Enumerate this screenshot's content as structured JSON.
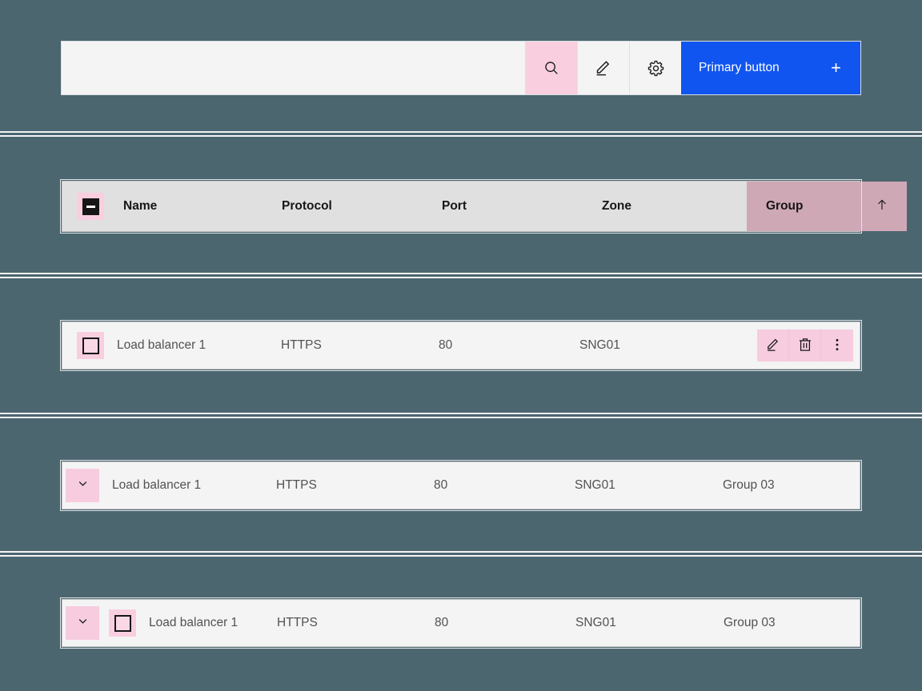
{
  "theme": {
    "background": "#4c6670",
    "surface": "#f4f4f4",
    "header_surface": "#e0e0e0",
    "accent_blue": "#1155f0",
    "highlight_pink": "#f9cfe0",
    "sorted_column": "#cfa8b6",
    "text_primary": "#161616",
    "text_secondary": "#525252",
    "divider": "#f4f4f4"
  },
  "toolbar": {
    "search": {
      "value": "",
      "placeholder": ""
    },
    "buttons": [
      {
        "name": "search-icon",
        "label": "Search",
        "state": "highlighted"
      },
      {
        "name": "edit-icon",
        "label": "Edit",
        "state": "default"
      },
      {
        "name": "gear-icon",
        "label": "Settings",
        "state": "default"
      }
    ],
    "primary_button": {
      "label": "Primary button",
      "icon": "plus-icon",
      "plus": "+"
    }
  },
  "table": {
    "header": {
      "select_all_checkbox": {
        "name": "select-all-checkbox",
        "state": "indeterminate"
      },
      "columns": [
        {
          "key": "name",
          "label": "Name",
          "sorted": false
        },
        {
          "key": "protocol",
          "label": "Protocol",
          "sorted": false
        },
        {
          "key": "port",
          "label": "Port",
          "sorted": false
        },
        {
          "key": "zone",
          "label": "Zone",
          "sorted": false
        },
        {
          "key": "group",
          "label": "Group",
          "sorted": true,
          "sort_direction": "ascending",
          "sort_icon": "arrow-up-icon"
        }
      ]
    },
    "rows": [
      {
        "variant": "selectable-with-actions",
        "checkbox": {
          "state": "unchecked"
        },
        "name": "Load balancer 1",
        "protocol": "HTTPS",
        "port": "80",
        "zone": "SNG01",
        "group": "",
        "actions": [
          {
            "name": "edit-row-button",
            "icon": "edit-icon",
            "label": "Edit"
          },
          {
            "name": "delete-row-button",
            "icon": "trash-icon",
            "label": "Delete"
          },
          {
            "name": "overflow-menu-button",
            "icon": "overflow-menu-icon",
            "label": "More options"
          }
        ]
      },
      {
        "variant": "expandable",
        "expand": {
          "name": "expand-row-button",
          "icon": "chevron-down-icon",
          "state": "collapsed"
        },
        "name": "Load balancer 1",
        "protocol": "HTTPS",
        "port": "80",
        "zone": "SNG01",
        "group": "Group 03",
        "actions": []
      },
      {
        "variant": "expandable-selectable",
        "expand": {
          "name": "expand-row-button",
          "icon": "chevron-down-icon",
          "state": "collapsed"
        },
        "checkbox": {
          "state": "unchecked"
        },
        "name": "Load balancer 1",
        "protocol": "HTTPS",
        "port": "80",
        "zone": "SNG01",
        "group": "Group 03",
        "actions": []
      }
    ]
  }
}
